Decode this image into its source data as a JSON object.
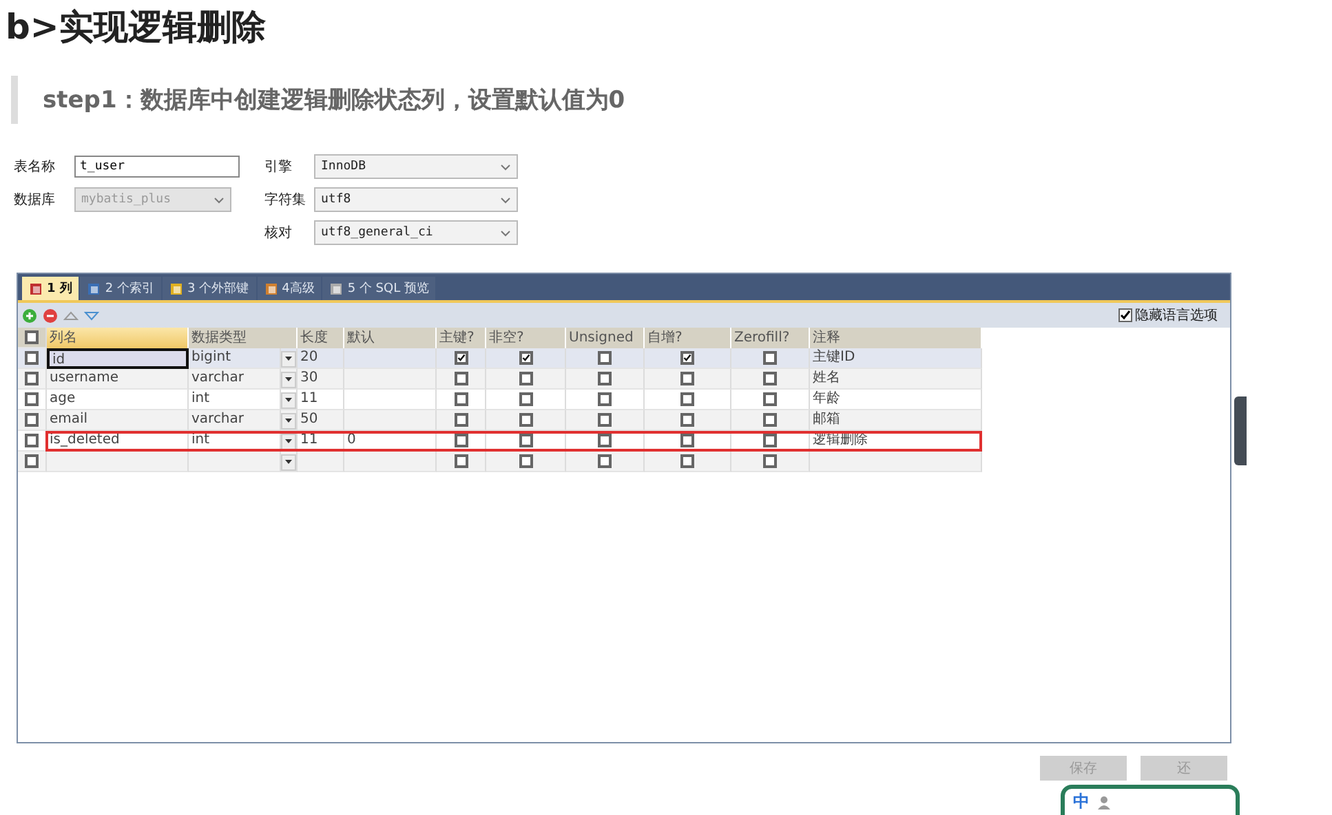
{
  "heading": "b>实现逻辑删除",
  "step_note": "step1：数据库中创建逻辑删除状态列，设置默认值为0",
  "form": {
    "left": [
      {
        "label": "表名称",
        "value": "t_user",
        "kind": "text",
        "disabled": false
      },
      {
        "label": "数据库",
        "value": "mybatis_plus",
        "kind": "select",
        "disabled": true
      }
    ],
    "right": [
      {
        "label": "引擎",
        "value": "InnoDB",
        "kind": "select",
        "disabled": false
      },
      {
        "label": "字符集",
        "value": "utf8",
        "kind": "select",
        "disabled": false
      },
      {
        "label": "核对",
        "value": "utf8_general_ci",
        "kind": "select",
        "disabled": false
      }
    ]
  },
  "tabs": [
    {
      "label": "1 列",
      "selected": true
    },
    {
      "label": "2 个索引",
      "selected": false
    },
    {
      "label": "3 个外部键",
      "selected": false
    },
    {
      "label": "4高级",
      "selected": false
    },
    {
      "label": "5 个 SQL 预览",
      "selected": false
    }
  ],
  "hide_language_options": {
    "label": "隐藏语言选项",
    "checked": true
  },
  "table": {
    "all_checked": false,
    "columns": [
      "列名",
      "数据类型",
      "长度",
      "默认",
      "主键?",
      "非空?",
      "Unsigned",
      "自增?",
      "Zerofill?",
      "注释"
    ],
    "rows": [
      {
        "checked": false,
        "name": "id",
        "type": "bigint",
        "length": "20",
        "primary_key": true,
        "not_null": true,
        "unsigned": false,
        "auto_increment": true,
        "zerofill": false,
        "comment": "主键ID",
        "selected": true,
        "highlighted": false
      },
      {
        "checked": false,
        "name": "username",
        "type": "varchar",
        "length": "30",
        "primary_key": false,
        "not_null": false,
        "unsigned": false,
        "auto_increment": false,
        "zerofill": false,
        "comment": "姓名",
        "selected": false,
        "highlighted": false
      },
      {
        "checked": false,
        "name": "age",
        "type": "int",
        "length": "11",
        "primary_key": false,
        "not_null": false,
        "unsigned": false,
        "auto_increment": false,
        "zerofill": false,
        "comment": "年龄",
        "selected": false,
        "highlighted": false
      },
      {
        "checked": false,
        "name": "email",
        "type": "varchar",
        "length": "50",
        "primary_key": false,
        "not_null": false,
        "unsigned": false,
        "auto_increment": false,
        "zerofill": false,
        "comment": "邮箱",
        "selected": false,
        "highlighted": false
      },
      {
        "checked": false,
        "name": "is_deleted",
        "type": "int",
        "length": "11",
        "default": "0",
        "primary_key": false,
        "not_null": false,
        "unsigned": false,
        "auto_increment": false,
        "zerofill": false,
        "comment": "逻辑删除",
        "selected": false,
        "highlighted": true
      },
      {
        "checked": false,
        "primary_key": false,
        "not_null": false,
        "unsigned": false,
        "auto_increment": false,
        "zerofill": false,
        "selected": false,
        "highlighted": false
      }
    ]
  },
  "buttons": [
    "保存",
    "还"
  ],
  "ime": {
    "label": "中"
  }
}
